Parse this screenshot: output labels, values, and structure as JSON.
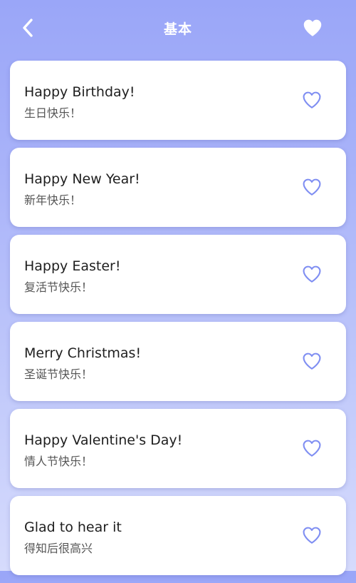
{
  "header": {
    "title": "基本",
    "back_icon": "chevron-left-icon",
    "favorite_icon": "heart-filled-icon"
  },
  "colors": {
    "accent": "#7f8ef2",
    "background_top": "#9aa6f8",
    "background_bottom": "#d6dbfc",
    "card": "#ffffff"
  },
  "phrases": [
    {
      "en": "Happy Birthday!",
      "zh": "生日快乐！",
      "icon": "heart-outline-icon"
    },
    {
      "en": "Happy New Year!",
      "zh": "新年快乐！",
      "icon": "heart-outline-icon"
    },
    {
      "en": "Happy Easter!",
      "zh": "复活节快乐！",
      "icon": "heart-outline-icon"
    },
    {
      "en": "Merry Christmas!",
      "zh": "圣诞节快乐！",
      "icon": "heart-outline-icon"
    },
    {
      "en": "Happy Valentine's Day!",
      "zh": "情人节快乐！",
      "icon": "heart-outline-icon"
    },
    {
      "en": "Glad to hear it",
      "zh": "得知后很高兴",
      "icon": "heart-outline-icon"
    }
  ]
}
